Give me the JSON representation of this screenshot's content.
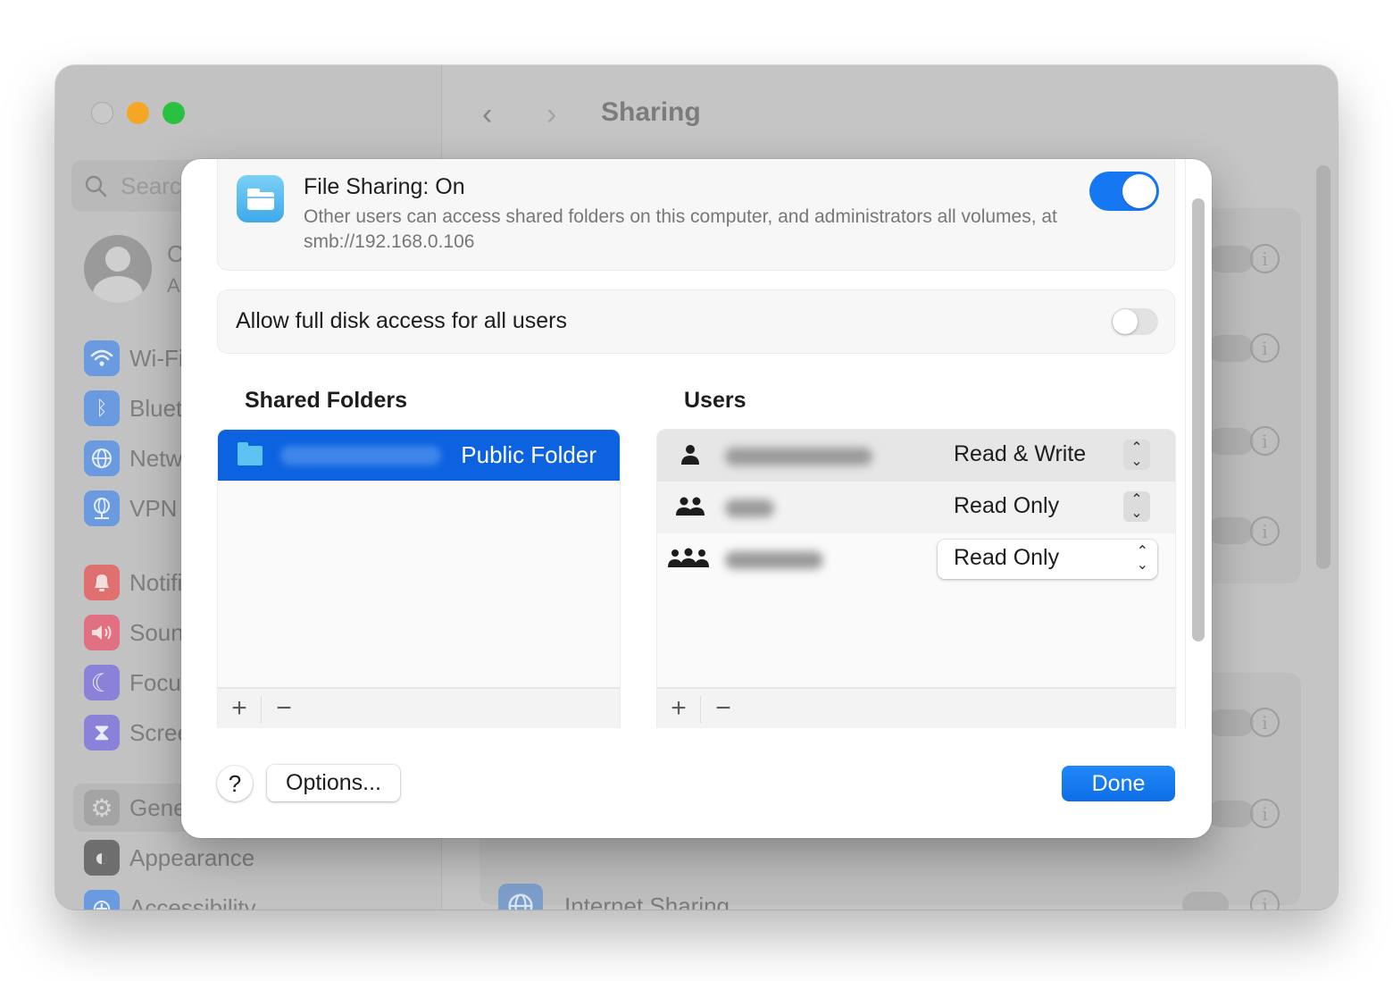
{
  "window": {
    "title": "Sharing",
    "traffic_lights": {
      "close": "close-button",
      "minimize": "minimize-button",
      "maximize": "maximize-button"
    },
    "nav": {
      "back_icon": "chevron-left-icon",
      "forward_icon": "chevron-right-icon",
      "back": "‹",
      "forward": "›"
    }
  },
  "sidebar": {
    "search_placeholder": "Search",
    "profile": {
      "name": "C",
      "subtitle": "A"
    },
    "items": [
      {
        "label": "Wi-Fi",
        "icon": "wifi-icon",
        "glyph": "◠",
        "color": "#6a9be0"
      },
      {
        "label": "Bluetooth",
        "icon": "bluetooth-icon",
        "glyph": "ᛒ",
        "color": "#6a9be0"
      },
      {
        "label": "Network",
        "icon": "globe-icon",
        "glyph": "◍",
        "color": "#6a9be0"
      },
      {
        "label": "VPN",
        "icon": "vpn-globe-icon",
        "glyph": "◍",
        "color": "#6a9be0"
      },
      {
        "label": "Notifications",
        "icon": "bell-icon",
        "glyph": "♪",
        "color": "#e07070"
      },
      {
        "label": "Sound",
        "icon": "speaker-icon",
        "glyph": "◀",
        "color": "#e07082"
      },
      {
        "label": "Focus",
        "icon": "moon-icon",
        "glyph": "☾",
        "color": "#8a82d8"
      },
      {
        "label": "Screen Time",
        "icon": "hourglass-icon",
        "glyph": "⧗",
        "color": "#8a82d8"
      },
      {
        "label": "General",
        "icon": "gear-icon",
        "glyph": "⚙",
        "color": "#a4a4a4"
      },
      {
        "label": "Appearance",
        "icon": "appearance-icon",
        "glyph": "◐",
        "color": "#6e6e6e"
      },
      {
        "label": "Accessibility",
        "icon": "accessibility-icon",
        "glyph": "⊕",
        "color": "#6a9be0"
      }
    ]
  },
  "background_list": {
    "visible_item": {
      "label": "Internet Sharing",
      "icon": "globe-icon"
    },
    "info_icon_glyph": "i"
  },
  "sheet": {
    "file_sharing": {
      "title": "File Sharing: On",
      "description": "Other users can access shared folders on this computer, and administrators all volumes, at smb://192.168.0.106",
      "enabled": true
    },
    "full_disk_access": {
      "label": "Allow full disk access for all users",
      "enabled": false
    },
    "shared_folders": {
      "heading": "Shared Folders",
      "items": [
        {
          "name": "Public Folder",
          "owner_redacted": true,
          "selected": true
        }
      ],
      "add_label": "+",
      "remove_label": "−"
    },
    "users": {
      "heading": "Users",
      "rows": [
        {
          "icon": "person-icon",
          "glyph": "👤",
          "name_redacted": true,
          "permission": "Read & Write",
          "selected": true
        },
        {
          "icon": "group-icon",
          "glyph": "👥",
          "name_redacted": true,
          "permission": "Read Only",
          "selected": false
        },
        {
          "icon": "everyone-icon",
          "glyph": "👥",
          "name_redacted": true,
          "permission": "Read Only",
          "selected": false
        }
      ],
      "add_label": "+",
      "remove_label": "−"
    },
    "stepper_glyph_up": "⌃",
    "stepper_glyph_down": "⌄",
    "buttons": {
      "help": "?",
      "options": "Options...",
      "done": "Done"
    },
    "colors": {
      "accent": "#0d6ee6",
      "selection": "#0d62e0"
    }
  }
}
